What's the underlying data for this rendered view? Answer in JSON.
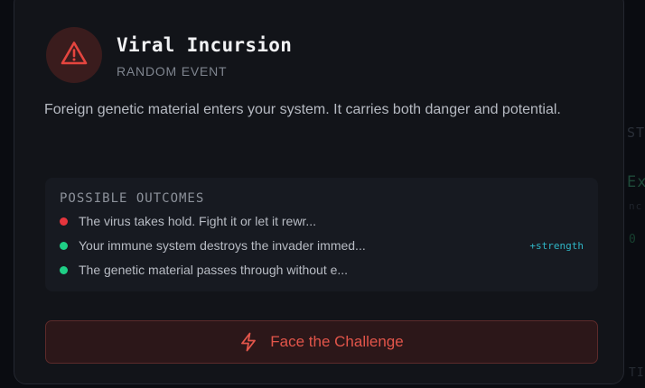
{
  "event": {
    "title": "Viral Incursion",
    "category": "RANDOM EVENT",
    "icon": "warning-triangle-icon",
    "description": "Foreign genetic material enters your system. It carries both danger and potential."
  },
  "outcomes": {
    "heading": "POSSIBLE OUTCOMES",
    "items": [
      {
        "text": "The virus takes hold. Fight it or let it rewr...",
        "status_color": "#e5353d",
        "tag": ""
      },
      {
        "text": "Your immune system destroys the invader immed...",
        "status_color": "#1fcf86",
        "tag": "+strength"
      },
      {
        "text": "The genetic material passes through without e...",
        "status_color": "#1fcf86",
        "tag": ""
      }
    ]
  },
  "action": {
    "label": "Face the Challenge",
    "icon": "lightning-bolt-icon"
  },
  "colors": {
    "danger": "#e5353d",
    "positive": "#1fcf86",
    "accent_cyan": "#2fb6c6",
    "card_bg": "#121419"
  }
}
